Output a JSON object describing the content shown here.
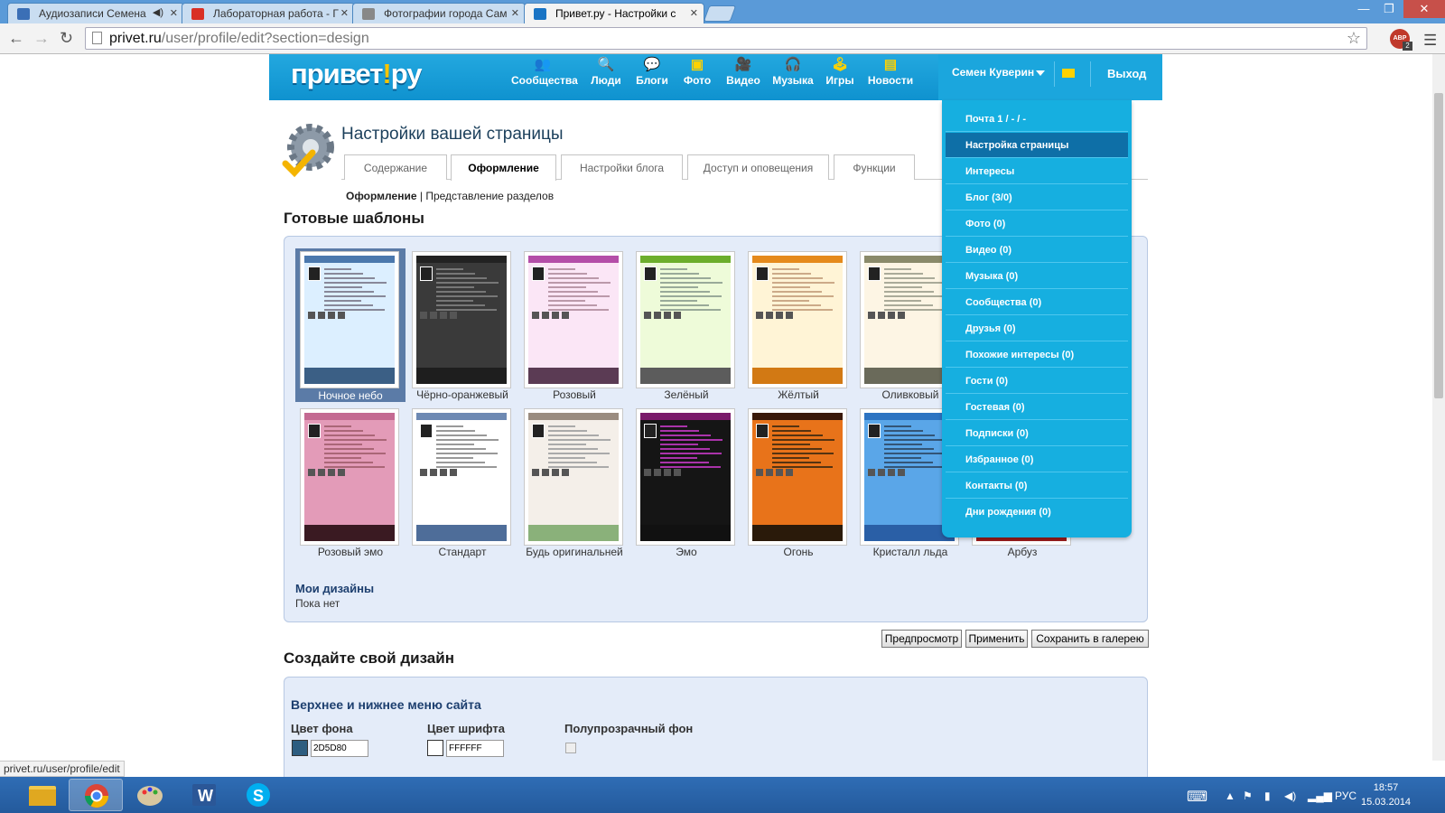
{
  "browser": {
    "tabs": [
      {
        "label": "Аудиозаписи Семена",
        "color": "#3b6fb6",
        "active": false
      },
      {
        "label": "Лабораторная работа - Г",
        "color": "#d93025",
        "active": false
      },
      {
        "label": "Фотографии города Сам",
        "color": "#888888",
        "active": false
      },
      {
        "label": "Привет.ру - Настройки с",
        "color": "#1a74c4",
        "active": true
      }
    ],
    "url_host": "privet.ru",
    "url_path": "/user/profile/edit?section=design",
    "abp_label": "ABP",
    "abp_count": "2",
    "window_controls": {
      "minimize": "—",
      "restore": "❐",
      "close": "✕"
    }
  },
  "site": {
    "logo_left": "привет",
    "logo_excl": "!",
    "logo_right": "ру",
    "nav": [
      {
        "label": "Сообщества",
        "icon": "people-group-icon",
        "glyph": "👥"
      },
      {
        "label": "Люди",
        "icon": "person-search-icon",
        "glyph": "🔍"
      },
      {
        "label": "Блоги",
        "icon": "speech-bubble-icon",
        "glyph": "💬"
      },
      {
        "label": "Фото",
        "icon": "photo-icon",
        "glyph": "▣"
      },
      {
        "label": "Видео",
        "icon": "film-icon",
        "glyph": "🎥"
      },
      {
        "label": "Музыка",
        "icon": "headphones-icon",
        "glyph": "🎧"
      },
      {
        "label": "Игры",
        "icon": "joystick-icon",
        "glyph": "🕹"
      },
      {
        "label": "Новости",
        "icon": "newspaper-icon",
        "glyph": "▤"
      }
    ],
    "user_name": "Семен Куверин",
    "logout": "Выход"
  },
  "dropdown": [
    "Почта 1 / - / -",
    "Настройка страницы",
    "Интересы",
    "Блог (3/0)",
    "Фото (0)",
    "Видео (0)",
    "Музыка (0)",
    "Сообщества (0)",
    "Друзья (0)",
    "Похожие интересы (0)",
    "Гости (0)",
    "Гостевая (0)",
    "Подписки (0)",
    "Избранное (0)",
    "Контакты (0)",
    "Дни рождения (0)"
  ],
  "page": {
    "title": "Настройки вашей страницы",
    "tabs": [
      "Содержание",
      "Оформление",
      "Настройки блога",
      "Доступ и оповещения",
      "Функции"
    ],
    "active_tab": "Оформление",
    "subnav_current": "Оформление",
    "subnav_sep": "|",
    "subnav_other": "Представление разделов",
    "templates_heading": "Готовые шаблоны",
    "templates": [
      {
        "name": "Ночное небо",
        "bg": "#dcefff",
        "hdr": "#4b78ad",
        "ftr": "#3b5f85",
        "line": "#889"
      },
      {
        "name": "Чёрно-оранжевый",
        "bg": "#3a3a3a",
        "hdr": "#222222",
        "ftr": "#1e1e1e",
        "line": "#777"
      },
      {
        "name": "Розовый",
        "bg": "#fbe6f6",
        "hdr": "#b44ea8",
        "ftr": "#5b3b54",
        "line": "#b9a"
      },
      {
        "name": "Зелёный",
        "bg": "#eefbd9",
        "hdr": "#6cae2c",
        "ftr": "#5c5c5c",
        "line": "#9a9"
      },
      {
        "name": "Жёлтый",
        "bg": "#fff4d6",
        "hdr": "#e58a1c",
        "ftr": "#d27914",
        "line": "#ca8"
      },
      {
        "name": "Оливковый",
        "bg": "#fdf5e4",
        "hdr": "#8a8a6a",
        "ftr": "#6a6a5a",
        "line": "#aa9"
      },
      {
        "name": "Розовый эмо",
        "bg": "#e39bb8",
        "hdr": "#c46a92",
        "ftr": "#3a1a22",
        "line": "#a67"
      },
      {
        "name": "Стандарт",
        "bg": "#ffffff",
        "hdr": "#6d89b3",
        "ftr": "#4e6d99",
        "line": "#999"
      },
      {
        "name": "Будь оригинальней",
        "bg": "#f4efe9",
        "hdr": "#9a8c80",
        "ftr": "#8ab17a",
        "line": "#aaa"
      },
      {
        "name": "Эмо",
        "bg": "#151515",
        "hdr": "#7a1a6a",
        "ftr": "#111111",
        "line": "#a3a"
      },
      {
        "name": "Огонь",
        "bg": "#e8731a",
        "hdr": "#3a1a0a",
        "ftr": "#2a1a0a",
        "line": "#531"
      },
      {
        "name": "Кристалл льда",
        "bg": "#5aa6e8",
        "hdr": "#2d74c2",
        "ftr": "#2a5fa6",
        "line": "#357"
      },
      {
        "name": "Арбуз",
        "bg": "#ffffff",
        "hdr": "#c72a2a",
        "ftr": "#9b1c1c",
        "line": "#999"
      }
    ],
    "my_designs": "Мои дизайны",
    "none_yet": "Пока нет",
    "buttons": {
      "preview": "Предпросмотр",
      "apply": "Применить",
      "save": "Сохранить в галерею"
    },
    "create_heading": "Создайте свой дизайн",
    "menu_heading": "Верхнее и нижнее меню сайта",
    "bg_color_label": "Цвет фона",
    "bg_color_value": "2D5D80",
    "bg_color_hex": "#2D5D80",
    "font_color_label": "Цвет шрифта",
    "font_color_value": "FFFFFF",
    "font_color_hex": "#FFFFFF",
    "transparent_label": "Полупрозрачный фон"
  },
  "status_url": "privet.ru/user/profile/edit",
  "taskbar": {
    "apps": [
      "file-explorer-icon",
      "chrome-icon",
      "paint-icon",
      "word-icon",
      "skype-icon"
    ],
    "lang": "РУС",
    "time": "18:57",
    "date": "15.03.2014"
  }
}
